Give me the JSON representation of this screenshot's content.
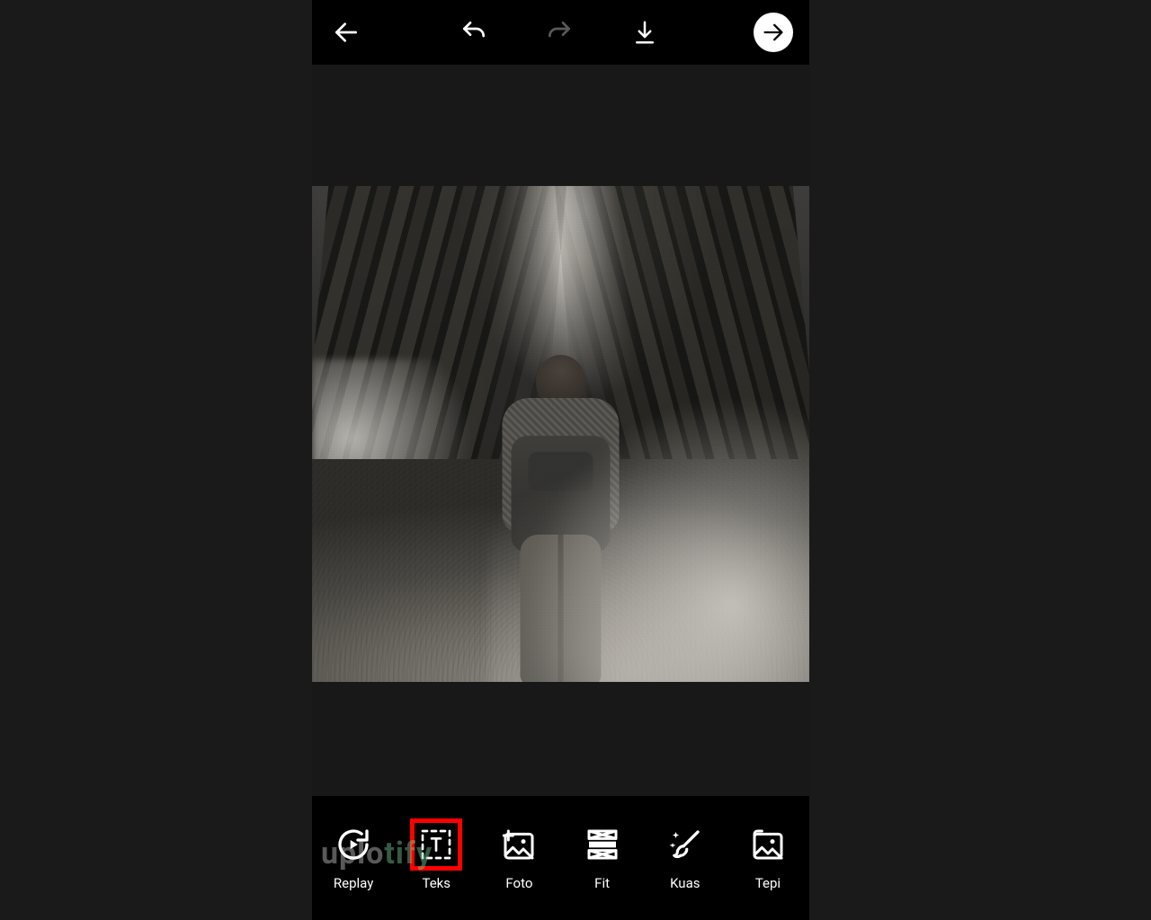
{
  "topbar": {
    "back": "back",
    "undo": "undo",
    "redo": "redo",
    "download": "download",
    "forward": "forward"
  },
  "tools": [
    {
      "id": "replay",
      "label": "Replay"
    },
    {
      "id": "teks",
      "label": "Teks",
      "highlighted": true
    },
    {
      "id": "foto",
      "label": "Foto"
    },
    {
      "id": "fit",
      "label": "Fit"
    },
    {
      "id": "kuas",
      "label": "Kuas"
    },
    {
      "id": "tepi",
      "label": "Tepi"
    }
  ],
  "watermark": {
    "part1": "uplo",
    "part2": "tify"
  },
  "highlight_color": "#ff0000"
}
